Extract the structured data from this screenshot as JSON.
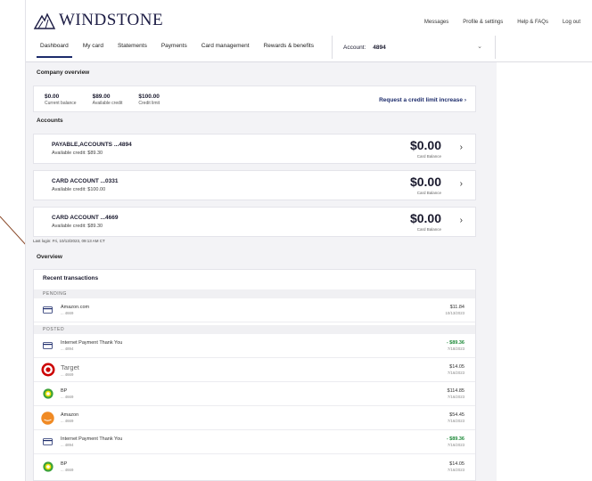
{
  "brand": {
    "name": "WINDSTONE"
  },
  "toplinks": [
    "Messages",
    "Profile & settings",
    "Help & FAQs",
    "Log out"
  ],
  "nav": [
    "Dashboard",
    "My card",
    "Statements",
    "Payments",
    "Card management",
    "Rewards & benefits"
  ],
  "account_selector": {
    "label": "Account:",
    "number": "4894"
  },
  "company_overview": {
    "title": "Company overview",
    "items": [
      {
        "value": "$0.00",
        "label": "Current balance"
      },
      {
        "value": "$89.00",
        "label": "Available credit"
      },
      {
        "value": "$100.00",
        "label": "Credit limit"
      }
    ],
    "link": "Request a credit limit increase"
  },
  "accounts": {
    "title": "Accounts",
    "items": [
      {
        "name": "PAYABLE,ACCOUNTS ...4894",
        "available": "Available credit: $89.30",
        "balance": "$0.00",
        "balance_label": "Card Balance"
      },
      {
        "name": "CARD ACCOUNT ...0331",
        "available": "Available credit: $100.00",
        "balance": "$0.00",
        "balance_label": "Card Balance"
      },
      {
        "name": "CARD ACCOUNT ...4669",
        "available": "Available credit: $89.30",
        "balance": "$0.00",
        "balance_label": "Card Balance"
      }
    ]
  },
  "last_login": "Last login: Fri, 10/13/2023, 09:13 AM CT",
  "overview_title": "Overview",
  "transactions": {
    "title": "Recent transactions",
    "pending_label": "PENDING",
    "posted_label": "POSTED",
    "pending": [
      {
        "icon": "card-icon",
        "merchant": "Amazon.com",
        "sub": "... 4669",
        "amount": "$11.84",
        "date": "10/13/2023"
      }
    ],
    "posted": [
      {
        "icon": "card-icon",
        "merchant": "Internet Payment Thank You",
        "sub": "... 4894",
        "amount": "- $89.36",
        "date": "7/18/2023",
        "credit": true
      },
      {
        "icon": "target-logo-icon",
        "merchant": "Target",
        "sub": "... 4669",
        "amount": "$14.05",
        "date": "7/16/2023"
      },
      {
        "icon": "bp-logo-icon",
        "merchant": "BP",
        "sub": "... 4669",
        "amount": "$114.85",
        "date": "7/16/2023"
      },
      {
        "icon": "amazon-logo-icon",
        "merchant": "Amazon",
        "sub": "... 4669",
        "amount": "$54.45",
        "date": "7/16/2023"
      },
      {
        "icon": "card-icon",
        "merchant": "Internet Payment Thank You",
        "sub": "... 4894",
        "amount": "- $89.36",
        "date": "7/16/2023",
        "credit": true
      },
      {
        "icon": "bp-logo-icon",
        "merchant": "BP",
        "sub": "... 4669",
        "amount": "$14.05",
        "date": "7/16/2023"
      }
    ]
  },
  "colors": {
    "brand": "#1c2b6b",
    "accent": "#1c2b6b",
    "credit": "#1f8a3a",
    "annotation": "#b5501c"
  }
}
